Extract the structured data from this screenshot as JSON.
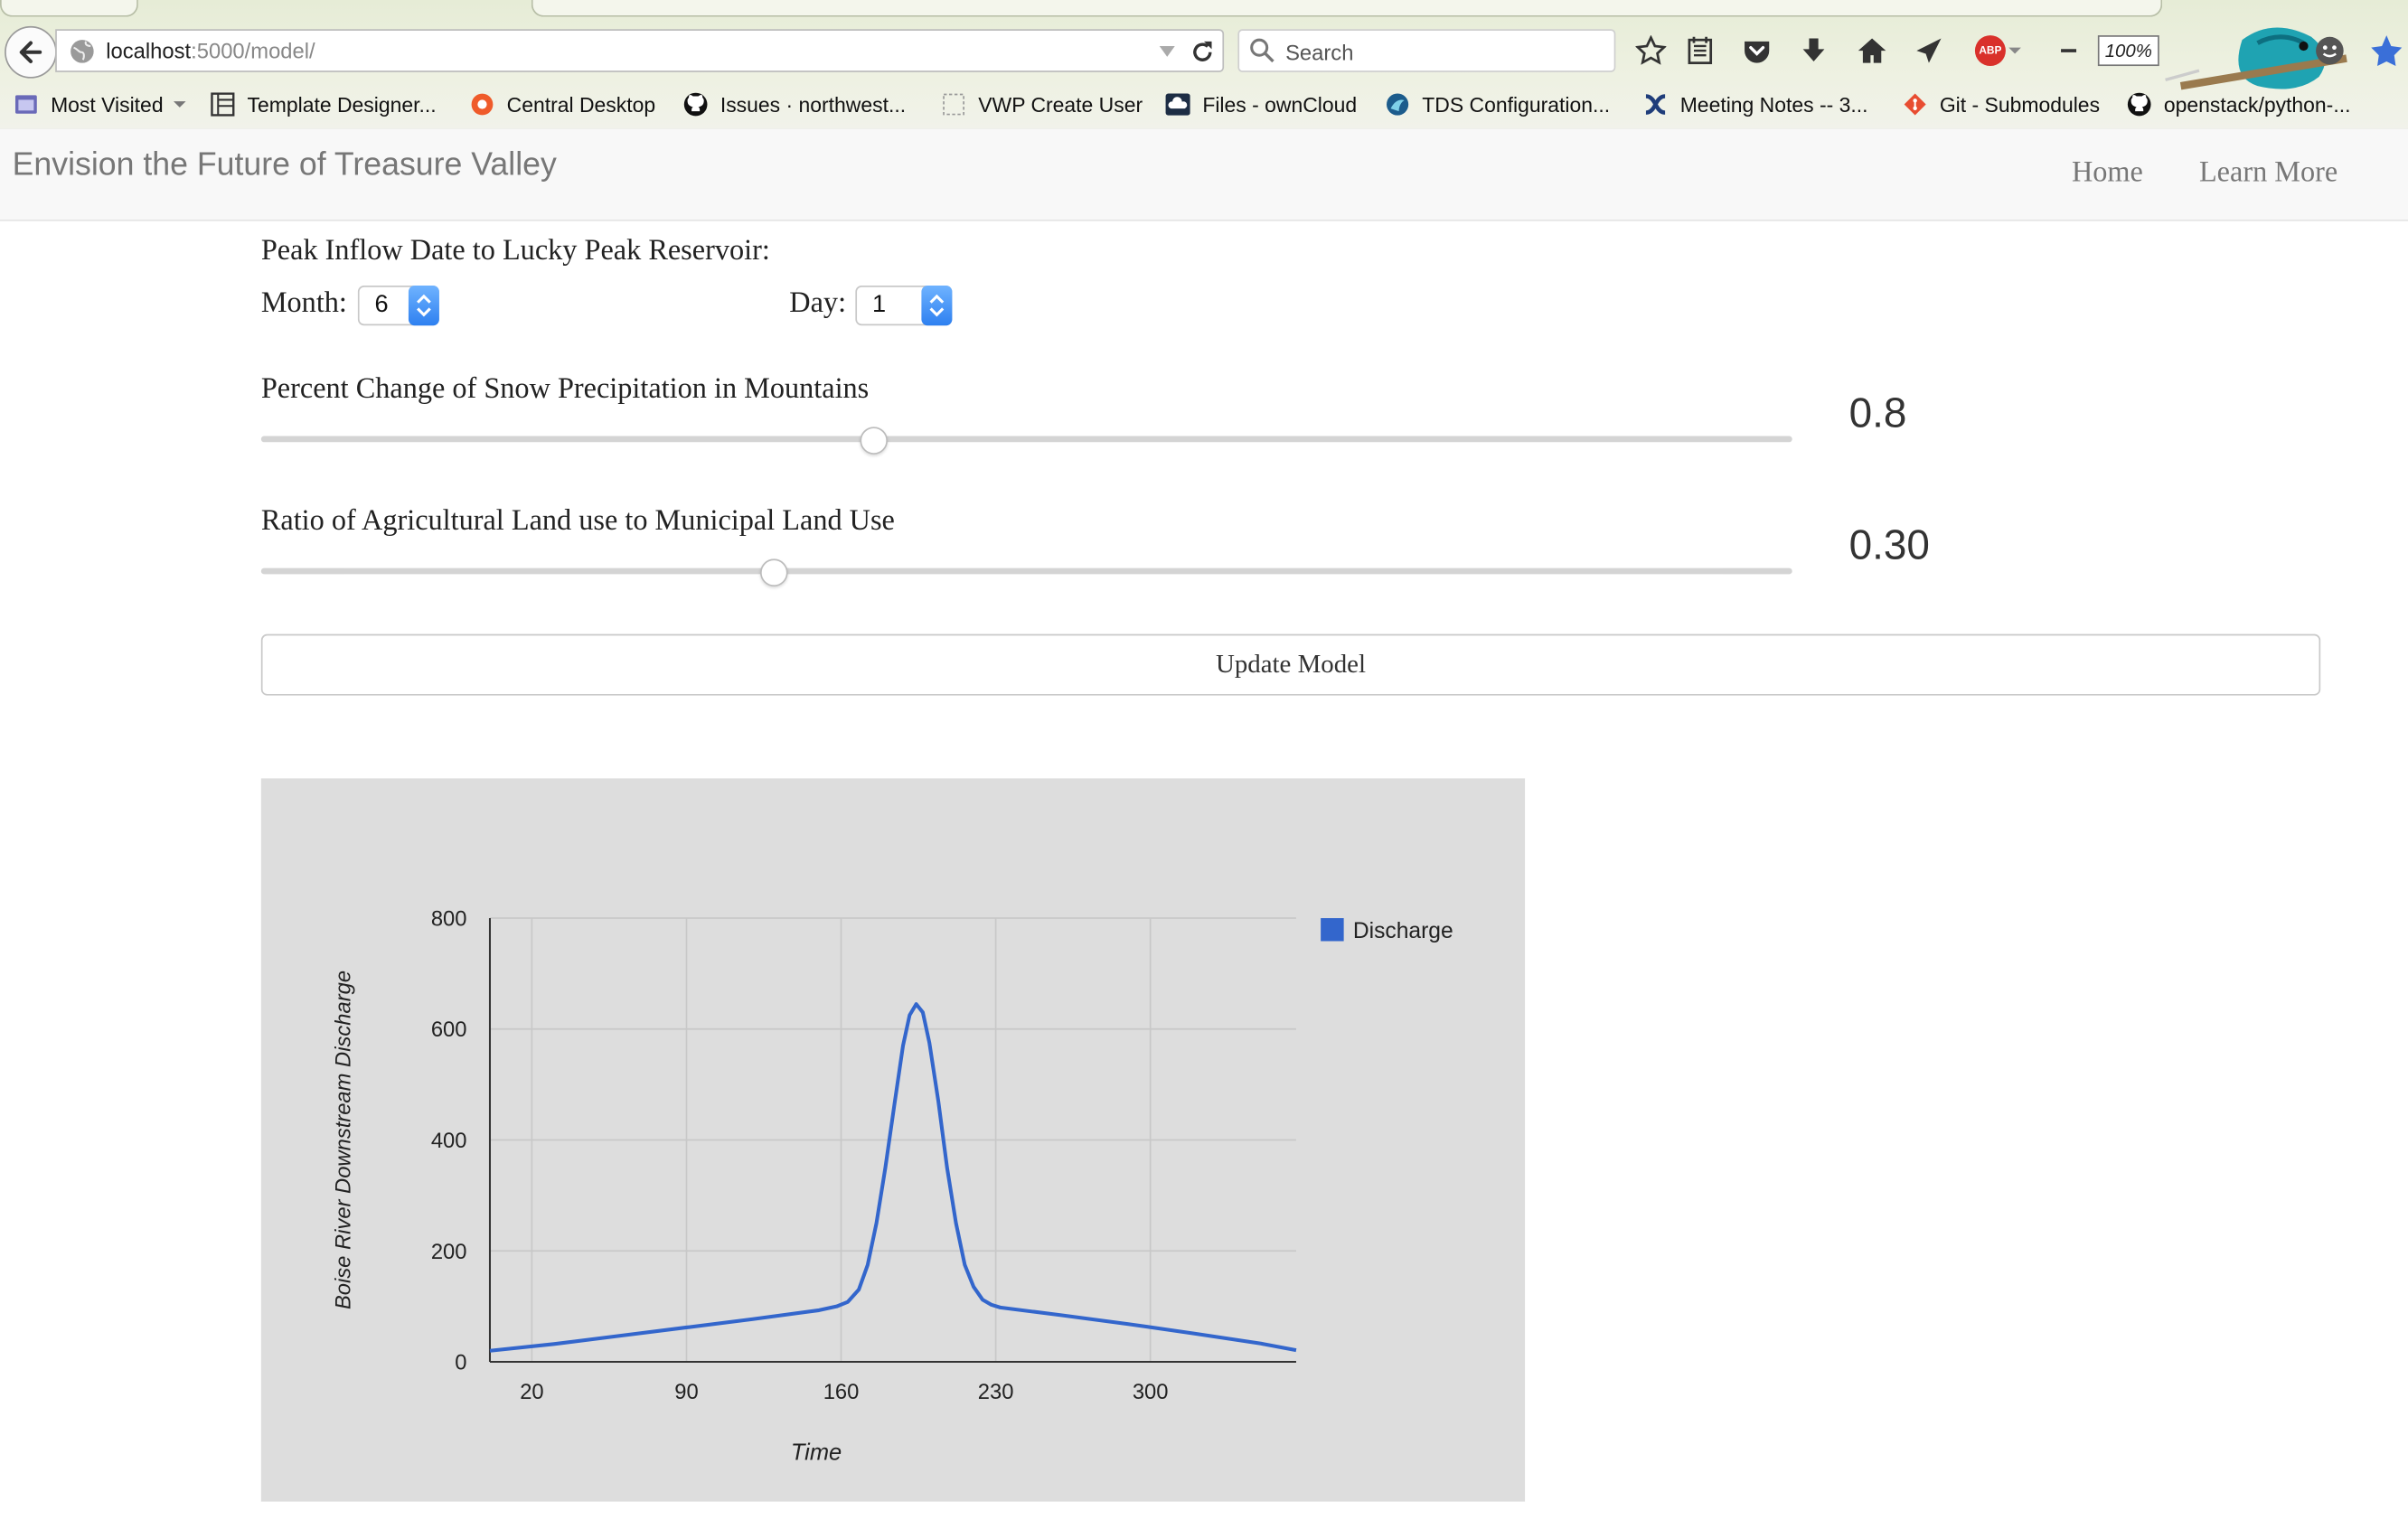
{
  "browser": {
    "url_host": "localhost",
    "url_path": ":5000/model/",
    "search_placeholder": "Search",
    "zoom": "100%",
    "bookmarks": [
      {
        "label": "Most Visited",
        "icon": "most-visited-icon"
      },
      {
        "label": "Template Designer...",
        "icon": "template-icon"
      },
      {
        "label": "Central Desktop",
        "icon": "central-desktop-icon"
      },
      {
        "label": "Issues · northwest...",
        "icon": "github-icon"
      },
      {
        "label": "VWP Create User",
        "icon": "blank-page-icon"
      },
      {
        "label": "Files - ownCloud",
        "icon": "owncloud-icon"
      },
      {
        "label": "TDS Configuration...",
        "icon": "tds-icon"
      },
      {
        "label": "Meeting Notes -- 3...",
        "icon": "confluence-icon"
      },
      {
        "label": "Git - Submodules",
        "icon": "git-icon"
      },
      {
        "label": "openstack/python-...",
        "icon": "github-icon"
      }
    ]
  },
  "navbar": {
    "brand": "Envision the Future of Treasure Valley",
    "links": [
      "Home",
      "Learn More"
    ]
  },
  "form": {
    "peak_title": "Peak Inflow Date to Lucky Peak Reservoir:",
    "month_label": "Month:",
    "month_value": "6",
    "day_label": "Day:",
    "day_value": "1",
    "snow_label": "Percent Change of Snow Precipitation in Mountains",
    "snow_value": "0.8",
    "snow_fraction": 0.4,
    "ag_label": "Ratio of Agricultural Land use to Municipal Land Use",
    "ag_value": "0.30",
    "ag_fraction": 0.335,
    "update_label": "Update Model"
  },
  "chart_data": {
    "type": "line",
    "xlabel": "Time",
    "ylabel": "Boise River Downstream Discharge",
    "xlim": [
      1,
      366
    ],
    "ylim": [
      0,
      800
    ],
    "xticks": [
      20,
      90,
      160,
      230,
      300
    ],
    "yticks": [
      0,
      200,
      400,
      600,
      800
    ],
    "grid": true,
    "legend_position": "right",
    "series": [
      {
        "name": "Discharge",
        "color": "#3366cc",
        "x": [
          1,
          30,
          60,
          90,
          120,
          150,
          158,
          163,
          168,
          172,
          176,
          180,
          184,
          188,
          191,
          194,
          197,
          200,
          204,
          208,
          212,
          216,
          220,
          224,
          228,
          232,
          260,
          290,
          320,
          350,
          366
        ],
        "y": [
          20,
          32,
          47,
          62,
          77,
          93,
          100,
          108,
          130,
          175,
          250,
          350,
          460,
          570,
          625,
          645,
          630,
          575,
          470,
          350,
          250,
          175,
          135,
          112,
          103,
          98,
          84,
          68,
          51,
          33,
          21
        ]
      }
    ]
  }
}
